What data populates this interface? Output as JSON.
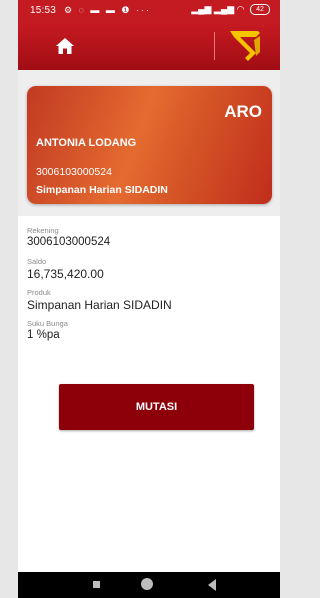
{
  "status_bar": {
    "time": "15:53",
    "notification_icons": "⚙ ◌ ▬ ▬ ❶ ···",
    "signal_icons": "▂▄▆ ▂▄▆ ◠",
    "battery": "42"
  },
  "app_bar": {
    "home_icon": "home-icon",
    "logo": "bank-logo"
  },
  "card": {
    "badge": "ARO",
    "holder_name": "ANTONIA LODANG",
    "account_number": "3006103000524",
    "product": "Simpanan Harian SIDADIN"
  },
  "details": {
    "rekening_label": "Rekening",
    "rekening_value": "3006103000524",
    "saldo_label": "Saldo",
    "saldo_value": "16,735,420.00",
    "produk_label": "Produk",
    "produk_value": "Simpanan Harian SIDADIN",
    "bunga_label": "Suku Bunga",
    "bunga_value": "1 %pa"
  },
  "actions": {
    "mutasi_label": "MUTASI"
  },
  "colors": {
    "primary": "#c41b23",
    "button": "#8e0009",
    "logo_yellow": "#f5c400"
  }
}
